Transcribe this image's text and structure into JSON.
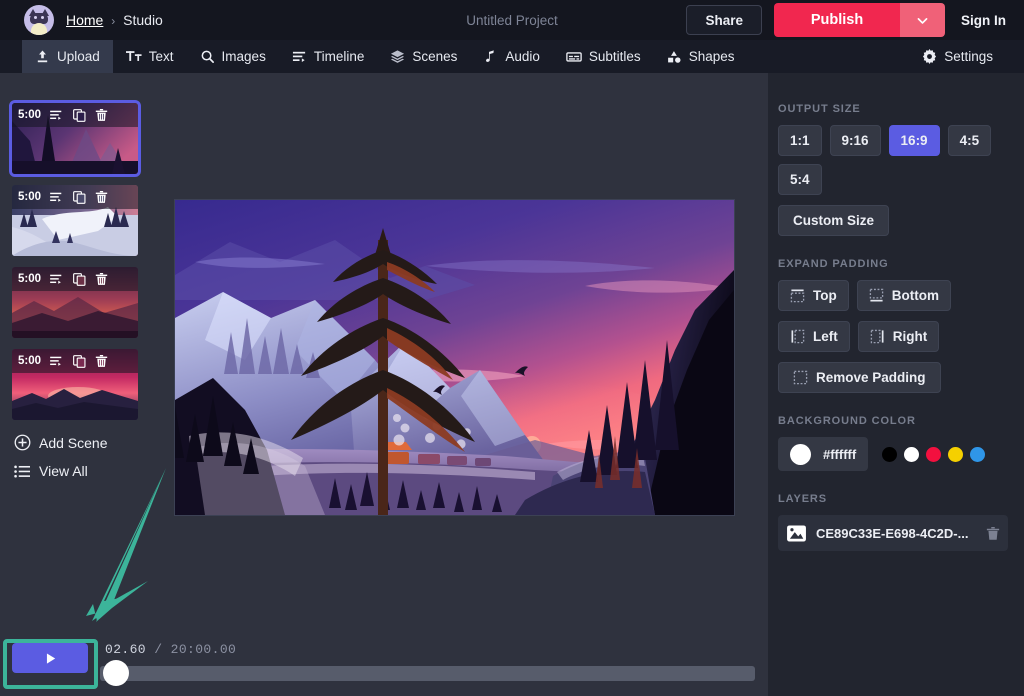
{
  "header": {
    "breadcrumb": {
      "home": "Home",
      "separator": "›",
      "current": "Studio"
    },
    "project_title": "Untitled Project",
    "share_label": "Share",
    "publish_label": "Publish",
    "signin_label": "Sign In",
    "avatar_name": "cat-avatar",
    "publish_color": "#f1274f",
    "publish_caret_color": "#f06178"
  },
  "toolbar": {
    "items": [
      {
        "label": "Upload",
        "icon": "upload-icon",
        "active": true
      },
      {
        "label": "Text",
        "icon": "text-icon",
        "active": false
      },
      {
        "label": "Images",
        "icon": "search-icon",
        "active": false
      },
      {
        "label": "Timeline",
        "icon": "timeline-icon",
        "active": false
      },
      {
        "label": "Scenes",
        "icon": "layers-icon",
        "active": false
      },
      {
        "label": "Audio",
        "icon": "music-note-icon",
        "active": false
      },
      {
        "label": "Subtitles",
        "icon": "subtitles-icon",
        "active": false
      },
      {
        "label": "Shapes",
        "icon": "shapes-icon",
        "active": false
      }
    ],
    "settings": {
      "label": "Settings",
      "icon": "gear-icon"
    }
  },
  "scenes": {
    "items": [
      {
        "duration": "5:00",
        "selected": true,
        "art": "dusk-forest"
      },
      {
        "duration": "5:00",
        "selected": false,
        "art": "snow-valley"
      },
      {
        "duration": "5:00",
        "selected": false,
        "art": "red-sunset"
      },
      {
        "duration": "5:00",
        "selected": false,
        "art": "pink-horizon"
      }
    ],
    "row_icons": [
      "reorder-icon",
      "duplicate-icon",
      "trash-icon"
    ],
    "add_scene_label": "Add Scene",
    "view_all_label": "View All"
  },
  "right_panel": {
    "output_size": {
      "label": "Output Size",
      "options": [
        "1:1",
        "9:16",
        "16:9",
        "4:5",
        "5:4"
      ],
      "selected": "16:9",
      "custom_label": "Custom Size",
      "accent": "#5b5ce2"
    },
    "expand_padding": {
      "label": "Expand Padding",
      "options": [
        "Top",
        "Bottom",
        "Left",
        "Right"
      ],
      "remove_label": "Remove Padding"
    },
    "background_color": {
      "label": "Background Color",
      "value": "#ffffff",
      "presets": [
        "#000000",
        "#ffffff",
        "#f3103f",
        "#f5d000",
        "#2f96e8"
      ]
    },
    "layers": {
      "label": "Layers",
      "items": [
        {
          "name": "CE89C33E-E698-4C2D-...",
          "icon": "image-icon",
          "delete_icon": "trash-icon"
        }
      ]
    }
  },
  "player": {
    "play_icon": "play-icon",
    "current_time": "02.60",
    "separator": "/",
    "total_time": "20:00.00",
    "progress_percent": 0,
    "highlight_color": "#3cb49a"
  },
  "annotation": {
    "arrow_color": "#3cb49a",
    "target": "play-button"
  }
}
